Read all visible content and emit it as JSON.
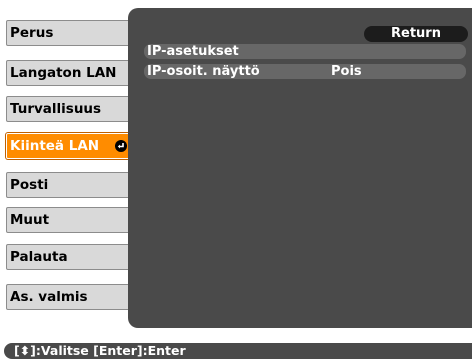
{
  "sidebar": {
    "items": [
      {
        "label": "Perus"
      },
      {
        "label": "Langaton LAN"
      },
      {
        "label": "Turvallisuus"
      },
      {
        "label": "Kiinteä LAN",
        "selected": true
      },
      {
        "label": "Posti"
      },
      {
        "label": "Muut"
      },
      {
        "label": "Palauta"
      },
      {
        "label": "As. valmis"
      }
    ]
  },
  "panel": {
    "return_label": "Return",
    "rows": [
      {
        "label": "IP-asetukset",
        "value": ""
      },
      {
        "label": "IP-osoit. näyttö",
        "value": "Pois"
      }
    ]
  },
  "footer": {
    "hint": "[⬍]:Valitse [Enter]:Enter"
  },
  "colors": {
    "selected_bg": "#ff8c00",
    "panel_bg": "#4a4a4a",
    "bar_bg": "#676767",
    "menu_bg": "#d9d9d9"
  }
}
